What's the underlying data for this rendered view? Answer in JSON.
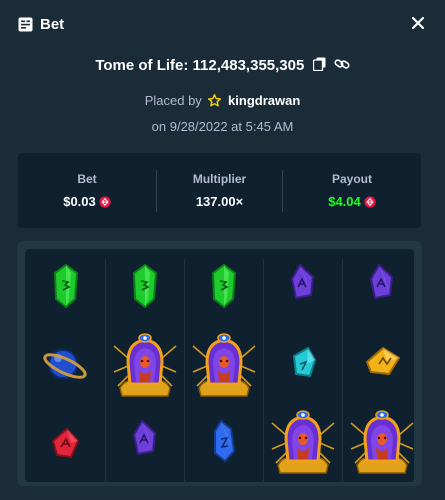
{
  "header": {
    "title": "Bet",
    "title_icon": "bet-slip-icon",
    "close_icon": "close-icon"
  },
  "game": {
    "label": "Tome of Life: 112,483,355,305",
    "copy_icon": "copy-icon",
    "link_icon": "link-icon"
  },
  "placed": {
    "prefix": "Placed by",
    "star_icon": "star-icon",
    "username": "kingdrawan",
    "date": "on 9/28/2022 at 5:45 AM"
  },
  "stats": {
    "bet": {
      "label": "Bet",
      "value": "$0.03",
      "currency_icon": "coin-icon"
    },
    "multiplier": {
      "label": "Multiplier",
      "value": "137.00×"
    },
    "payout": {
      "label": "Payout",
      "value": "$4.04",
      "currency_icon": "coin-icon"
    }
  },
  "colors": {
    "background": "#1a2c38",
    "panel": "#0f212e",
    "board_frame": "#213743",
    "payout_green": "#1fff20",
    "muted_text": "#b1bad3"
  },
  "reels": [
    [
      "green-gem",
      "blue-orb",
      "red-gem"
    ],
    [
      "green-gem",
      "owl-totem",
      "purple-gem"
    ],
    [
      "green-gem",
      "owl-totem",
      "blue-gem"
    ],
    [
      "purple-gem",
      "cyan-gem",
      "owl-totem"
    ],
    [
      "purple-gem",
      "yellow-gem",
      "owl-totem"
    ]
  ]
}
